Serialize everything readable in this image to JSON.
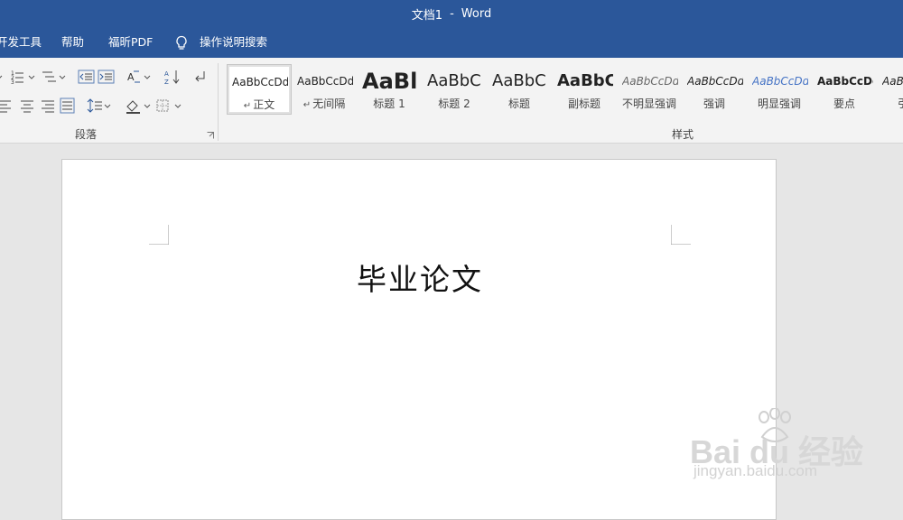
{
  "window": {
    "doc_name": "文档1",
    "separator": "-",
    "app_name": "Word"
  },
  "tabs": [
    {
      "label": "开发工具"
    },
    {
      "label": "帮助"
    },
    {
      "label": "福昕PDF"
    }
  ],
  "tell_me": {
    "label": "操作说明搜索",
    "icon": "lightbulb-icon"
  },
  "ribbon": {
    "paragraph_group_label": "段落",
    "styles_group_label": "样式",
    "paragraph_icons": [
      "bullets-dropdown-icon",
      "numbering-icon",
      "multilevel-list-icon",
      "decrease-indent-icon",
      "increase-indent-icon",
      "chinese-layout-icon",
      "sort-icon",
      "show-marks-icon",
      "align-left-icon",
      "center-icon",
      "align-right-icon",
      "justify-icon",
      "distributed-icon",
      "line-spacing-icon",
      "shading-icon",
      "borders-icon"
    ],
    "styles": [
      {
        "sample": "AaBbCcDd",
        "name": "正文",
        "para_mark": "↵",
        "selected": true
      },
      {
        "sample": "AaBbCcDd",
        "name": "无间隔",
        "para_mark": "↵"
      },
      {
        "sample": "AaBl",
        "name": "标题 1"
      },
      {
        "sample": "AaBbC",
        "name": "标题 2"
      },
      {
        "sample": "AaBbC",
        "name": "标题"
      },
      {
        "sample": "AaBbC",
        "name": "副标题"
      },
      {
        "sample": "AaBbCcDd",
        "name": "不明显强调"
      },
      {
        "sample": "AaBbCcDd",
        "name": "强调"
      },
      {
        "sample": "AaBbCcDd",
        "name": "明显强调"
      },
      {
        "sample": "AaBbCcDd",
        "name": "要点"
      },
      {
        "sample": "AaBbCcDd",
        "name": "引"
      }
    ]
  },
  "document": {
    "title_text": "毕业论文"
  },
  "watermark": {
    "logo_text": "Bai du 经验",
    "url": "jingyan.baidu.com"
  },
  "colors": {
    "title_bar": "#2b579a",
    "ribbon_bg": "#f3f3f3",
    "workspace_bg": "#e6e6e6",
    "emphasis_blue": "#4472c4"
  }
}
